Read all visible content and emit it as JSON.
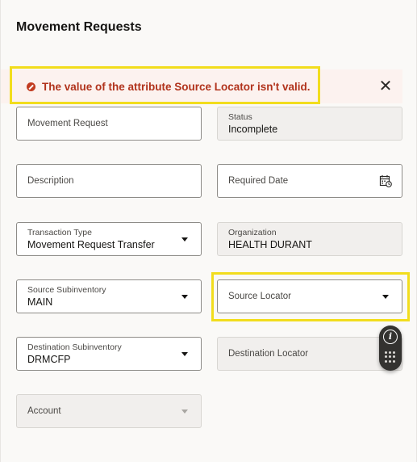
{
  "page": {
    "title": "Movement Requests"
  },
  "error": {
    "message": "The value of the attribute Source Locator isn't valid.",
    "close_label": "✕"
  },
  "fields": {
    "movement_request": {
      "label": "Movement Request"
    },
    "status": {
      "label": "Status",
      "value": "Incomplete"
    },
    "description": {
      "label": "Description"
    },
    "required_date": {
      "label": "Required Date"
    },
    "transaction_type": {
      "label": "Transaction Type",
      "value": "Movement Request Transfer"
    },
    "organization": {
      "label": "Organization",
      "value": "HEALTH DURANT"
    },
    "source_subinventory": {
      "label": "Source Subinventory",
      "value": "MAIN"
    },
    "source_locator": {
      "label": "Source Locator"
    },
    "destination_subinventory": {
      "label": "Destination Subinventory",
      "value": "DRMCFP"
    },
    "destination_locator": {
      "label": "Destination Locator"
    },
    "account": {
      "label": "Account"
    }
  },
  "assistant": {
    "info_glyph": "i"
  },
  "colors": {
    "error_text": "#b1331c",
    "highlight": "#f2dd1d",
    "border": "#8e8c88"
  }
}
